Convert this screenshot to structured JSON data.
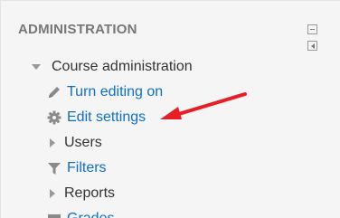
{
  "block": {
    "title": "ADMINISTRATION",
    "controls": [
      {
        "name": "hide-block-icon"
      },
      {
        "name": "dock-block-icon"
      }
    ]
  },
  "tree": {
    "root": {
      "label": "Course administration",
      "icon": "expanded-arrow-icon"
    },
    "items": [
      {
        "label": "Turn editing on",
        "icon": "pencil-icon",
        "link": true
      },
      {
        "label": "Edit settings",
        "icon": "gear-icon",
        "link": true
      },
      {
        "label": "Users",
        "icon": "collapsed-arrow-icon",
        "link": false
      },
      {
        "label": "Filters",
        "icon": "filter-icon",
        "link": true
      },
      {
        "label": "Reports",
        "icon": "collapsed-arrow-icon",
        "link": false
      },
      {
        "label": "Grades",
        "icon": "grades-icon",
        "link": true
      }
    ]
  },
  "colors": {
    "block_bg": "#f5f5f5",
    "title": "#777777",
    "text": "#333333",
    "link": "#0f6fc5",
    "icon": "#8a8a8a",
    "annotation_arrow": "#e81e25"
  },
  "annotation": {
    "icon": "red-pointer-arrow-icon"
  }
}
